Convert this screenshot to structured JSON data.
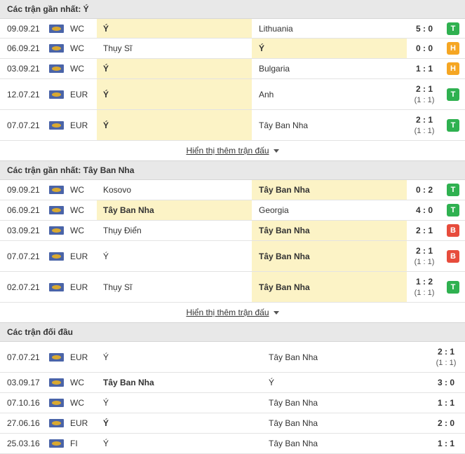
{
  "section1": {
    "title": "Các trận gần nhất: Ý",
    "more": "Hiển thị thêm trận đấu",
    "rows": [
      {
        "date": "09.09.21",
        "comp": "WC",
        "home": "Ý",
        "away": "Lithuania",
        "score": "5 : 0",
        "ht": "",
        "result": "T"
      },
      {
        "date": "06.09.21",
        "comp": "WC",
        "home": "Thụy Sĩ",
        "away": "Ý",
        "score": "0 : 0",
        "ht": "",
        "result": "H"
      },
      {
        "date": "03.09.21",
        "comp": "WC",
        "home": "Ý",
        "away": "Bulgaria",
        "score": "1 : 1",
        "ht": "",
        "result": "H"
      },
      {
        "date": "12.07.21",
        "comp": "EUR",
        "home": "Ý",
        "away": "Anh",
        "score": "2 : 1",
        "ht": "(1 : 1)",
        "result": "T"
      },
      {
        "date": "07.07.21",
        "comp": "EUR",
        "home": "Ý",
        "away": "Tây Ban Nha",
        "score": "2 : 1",
        "ht": "(1 : 1)",
        "result": "T"
      }
    ]
  },
  "section2": {
    "title": "Các trận gần nhất: Tây Ban Nha",
    "more": "Hiển thị thêm trận đấu",
    "rows": [
      {
        "date": "09.09.21",
        "comp": "WC",
        "home": "Kosovo",
        "away": "Tây Ban Nha",
        "score": "0 : 2",
        "ht": "",
        "result": "T"
      },
      {
        "date": "06.09.21",
        "comp": "WC",
        "home": "Tây Ban Nha",
        "away": "Georgia",
        "score": "4 : 0",
        "ht": "",
        "result": "T"
      },
      {
        "date": "03.09.21",
        "comp": "WC",
        "home": "Thụy Điển",
        "away": "Tây Ban Nha",
        "score": "2 : 1",
        "ht": "",
        "result": "B"
      },
      {
        "date": "07.07.21",
        "comp": "EUR",
        "home": "Ý",
        "away": "Tây Ban Nha",
        "score": "2 : 1",
        "ht": "(1 : 1)",
        "result": "B"
      },
      {
        "date": "02.07.21",
        "comp": "EUR",
        "home": "Thụy Sĩ",
        "away": "Tây Ban Nha",
        "score": "1 : 2",
        "ht": "(1 : 1)",
        "result": "T"
      }
    ]
  },
  "section3": {
    "title": "Các trận đối đầu",
    "rows": [
      {
        "date": "07.07.21",
        "comp": "EUR",
        "home": "Ý",
        "away": "Tây Ban Nha",
        "score": "2 : 1",
        "ht": "(1 : 1)"
      },
      {
        "date": "03.09.17",
        "comp": "WC",
        "home": "Tây Ban Nha",
        "away": "Ý",
        "score": "3 : 0",
        "ht": ""
      },
      {
        "date": "07.10.16",
        "comp": "WC",
        "home": "Ý",
        "away": "Tây Ban Nha",
        "score": "1 : 1",
        "ht": ""
      },
      {
        "date": "27.06.16",
        "comp": "EUR",
        "home": "Ý",
        "away": "Tây Ban Nha",
        "score": "2 : 0",
        "ht": ""
      },
      {
        "date": "25.03.16",
        "comp": "FI",
        "home": "Ý",
        "away": "Tây Ban Nha",
        "score": "1 : 1",
        "ht": ""
      }
    ]
  },
  "colors": {
    "win": "#2fb150",
    "draw": "#f5a623",
    "loss": "#e74c3c",
    "highlight": "#fcf3c6"
  }
}
